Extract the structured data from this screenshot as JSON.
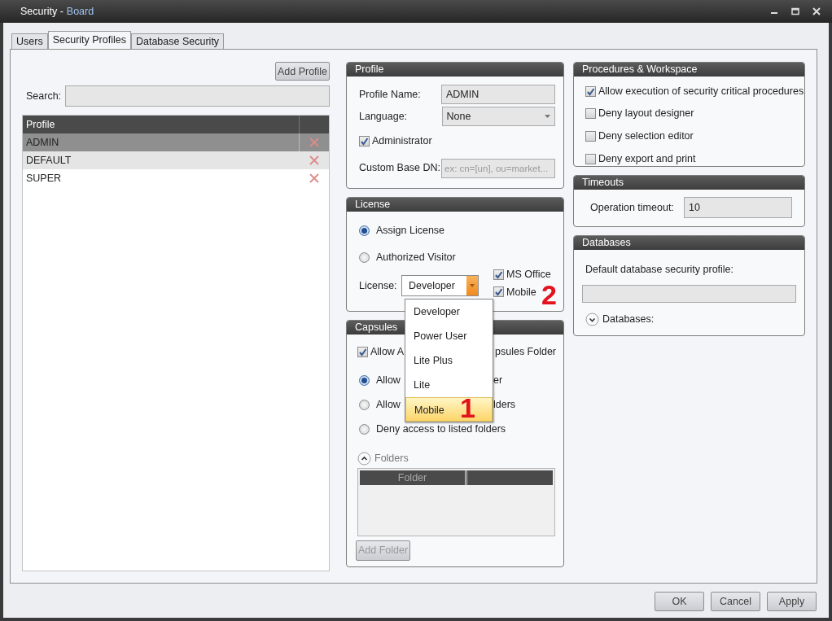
{
  "window": {
    "title": "Security -",
    "subtitle": "Board"
  },
  "tabs": [
    {
      "label": "Users",
      "selected": false
    },
    {
      "label": "Security Profiles",
      "selected": true
    },
    {
      "label": "Database Security",
      "selected": false
    }
  ],
  "profiles_pane": {
    "add_button": "Add Profile",
    "search_label": "Search:",
    "table": {
      "columns": [
        "Profile"
      ],
      "rows": [
        {
          "name": "ADMIN",
          "selected": true
        },
        {
          "name": "DEFAULT",
          "selected": false
        },
        {
          "name": "SUPER",
          "selected": false
        }
      ]
    }
  },
  "profile": {
    "title": "Profile",
    "fields": [
      {
        "kind": "text",
        "label": "Profile Name:",
        "value": "ADMIN"
      },
      {
        "kind": "select",
        "label": "Language:",
        "value": "None"
      },
      {
        "kind": "checkbox",
        "label": "Administrator",
        "checked": true
      },
      {
        "kind": "text",
        "label": "Custom Base DN:",
        "placeholder": "ex: cn=[un], ou=market..."
      }
    ]
  },
  "license": {
    "title": "License",
    "options": [
      {
        "label": "Assign License",
        "selected": true
      },
      {
        "label": "Authorized Visitor",
        "selected": false
      }
    ],
    "license_label": "License:",
    "license_value": "Developer",
    "extras": [
      {
        "label": "MS Office",
        "checked": true
      },
      {
        "label": "Mobile",
        "checked": true
      }
    ],
    "dropdown": {
      "items": [
        {
          "label": "Developer",
          "selected": false
        },
        {
          "label": "Power User",
          "selected": false
        },
        {
          "label": "Lite Plus",
          "selected": false
        },
        {
          "label": "Lite",
          "selected": false
        },
        {
          "label": "Mobile",
          "selected": true
        }
      ]
    }
  },
  "capsules": {
    "title": "Capsules",
    "allow_folder": {
      "label_parts": [
        "Allow A",
        "psules Folder"
      ],
      "checked": true
    },
    "access_options": [
      {
        "label_parts": [
          "Allow",
          "er"
        ],
        "selected": true
      },
      {
        "label_parts": [
          "Allow",
          "lders"
        ],
        "selected": false
      },
      {
        "label_parts": [
          "Deny access to listed folders"
        ],
        "selected": false
      }
    ],
    "folders": {
      "label": "Folders",
      "expanded": true,
      "columns": [
        "Folder"
      ]
    },
    "add_button": {
      "label": "Add Folder",
      "disabled": true
    }
  },
  "procedures": {
    "title": "Procedures & Workspace",
    "options": [
      {
        "label": "Allow execution of security critical procedures",
        "checked": true
      },
      {
        "label": "Deny layout designer",
        "checked": false
      },
      {
        "label": "Deny selection editor",
        "checked": false
      },
      {
        "label": "Deny export and print",
        "checked": false
      }
    ]
  },
  "timeouts": {
    "title": "Timeouts",
    "label": "Operation timeout:",
    "value": "10"
  },
  "databases": {
    "title": "Databases",
    "label": "Default database security profile:",
    "expander": {
      "label": "Databases:",
      "expanded": false
    }
  },
  "buttons": [
    "OK",
    "Cancel",
    "Apply"
  ],
  "annotations": [
    {
      "label": "1"
    },
    {
      "label": "2"
    }
  ]
}
